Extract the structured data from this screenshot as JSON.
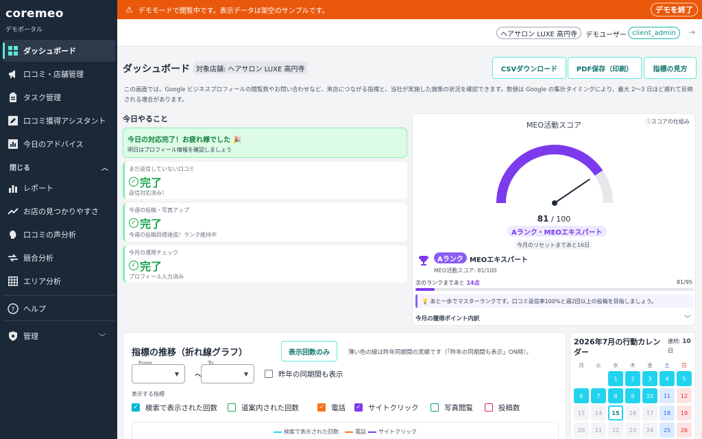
{
  "app": {
    "logo": "coremeo",
    "portal": "デモポータル"
  },
  "sidebar": {
    "items": [
      {
        "label": "ダッシュボード",
        "icon": "grid-icon"
      },
      {
        "label": "口コミ・店舗管理",
        "icon": "megaphone-icon"
      },
      {
        "label": "タスク管理",
        "icon": "clipboard-icon"
      },
      {
        "label": "口コミ獲得アシスタント",
        "icon": "edit-icon"
      },
      {
        "label": "今日のアドバイス",
        "icon": "chart-icon"
      }
    ],
    "section_label": "閉じる",
    "section_items": [
      {
        "label": "レポート",
        "icon": "bar-chart-icon"
      },
      {
        "label": "お店の見つかりやすさ",
        "icon": "trend-up-icon"
      },
      {
        "label": "口コミの声分析",
        "icon": "head-icon"
      },
      {
        "label": "競合分析",
        "icon": "compare-icon"
      },
      {
        "label": "エリア分析",
        "icon": "table-icon"
      }
    ],
    "help": "ヘルプ",
    "admin": "管理"
  },
  "banner": {
    "message": "デモモードで閲覧中です。表示データは架空のサンプルです。",
    "end_button": "デモを終了"
  },
  "user": {
    "store": "ヘアサロン LUXE 高円寺",
    "demo_user_label": "デモユーザー",
    "role": "client_admin"
  },
  "header": {
    "title": "ダッシュボード",
    "target_store": "対象店舗: ヘアサロン LUXE 高円寺",
    "buttons": [
      "CSVダウンロード",
      "PDF保存（印刷）",
      "指標の見方"
    ],
    "description": "この画面では、Google ビジネスプロフィールの閲覧数やお問い合わせなど、来店につながる指標と、当社が実施した施策の状況を確認できます。数値は Google の集計タイミングにより、最大 2〜3 日ほど遅れて反映される場合があります。"
  },
  "todo": {
    "title": "今日やること",
    "banner_title": "今日の対応完了！お疲れ様でした 🎉",
    "banner_sub": "明日はプロフィール情報を確認しましょう",
    "cards": [
      {
        "label": "まだ返信していない口コミ",
        "status": "完了",
        "sub": "返信対応済み！"
      },
      {
        "label": "今週の投稿・写真アップ",
        "status": "完了",
        "sub": "今週の投稿目標達成！ランク維持中"
      },
      {
        "label": "今月の運用チェック",
        "status": "完了",
        "sub": "プロフィール入力済み"
      }
    ]
  },
  "score": {
    "title": "MEO活動スコア",
    "help": "スコアの仕組み",
    "value": "81",
    "max": "/ 100",
    "value_num": 81,
    "rank_chip": "Aランク・MEOエキスパート",
    "reset": "今月のリセットまであと16日",
    "rank_badge": "Aランク",
    "rank_name": "MEOエキスパート",
    "rank_score": "MEO活動スコア: 81/100",
    "next_prefix": "次のランクまであと",
    "next_points": "14点",
    "next_value": "81/95",
    "progress_fraction": 0.07,
    "tip": "💡 あと一歩でマスターランクです。口コミ返信率100%と週2回以上の投稿を目指しましょう。",
    "points_title": "今月の獲得ポイント内訳",
    "colors": {
      "gauge": "#7c3aed",
      "track": "#e5e7eb"
    }
  },
  "trend": {
    "title": "指標の推移（折れ線グラフ）",
    "show_only": "表示回数のみ",
    "note": "薄い色の線は昨年同期間の実績です（「昨年の同期間も表示」ON時）。",
    "from_label": "From",
    "to_label": "To",
    "tilde": "〜",
    "last_year": "昨年の同期間も表示",
    "metric_title": "表示する指標",
    "metrics": [
      {
        "label": "検索で表示された回数",
        "checked": true,
        "color": "#06b6d4"
      },
      {
        "label": "道案内された回数",
        "checked": false,
        "color": "#16a34a"
      },
      {
        "label": "電話",
        "checked": true,
        "color": "#f97316"
      },
      {
        "label": "サイトクリック",
        "checked": true,
        "color": "#7c3aed"
      },
      {
        "label": "写真閲覧",
        "checked": false,
        "color": "#0d9488"
      },
      {
        "label": "投稿数",
        "checked": false,
        "color": "#e11d48"
      }
    ],
    "legend": [
      {
        "label": "検索で表示された回数",
        "color": "#22d3ee"
      },
      {
        "label": "電話",
        "color": "#f97316"
      },
      {
        "label": "サイトクリック",
        "color": "#7c3aed"
      }
    ]
  },
  "calendar": {
    "title": "2026年7月の行動カレンダー",
    "streak_label": "連続:",
    "streak_value": "10",
    "streak_unit": "日",
    "dow": [
      "月",
      "火",
      "水",
      "木",
      "金",
      "土",
      "日"
    ],
    "weeks": [
      [
        "",
        "",
        "1",
        "2",
        "3",
        "4",
        "5"
      ],
      [
        "6",
        "7",
        "8",
        "9",
        "10",
        "11",
        "12"
      ],
      [
        "13",
        "14",
        "15",
        "16",
        "17",
        "18",
        "19"
      ],
      [
        "20",
        "21",
        "22",
        "23",
        "24",
        "25",
        "26"
      ]
    ],
    "active_days": [
      "1",
      "2",
      "3",
      "4",
      "5",
      "6",
      "7",
      "8",
      "9",
      "10"
    ],
    "today": "15"
  }
}
